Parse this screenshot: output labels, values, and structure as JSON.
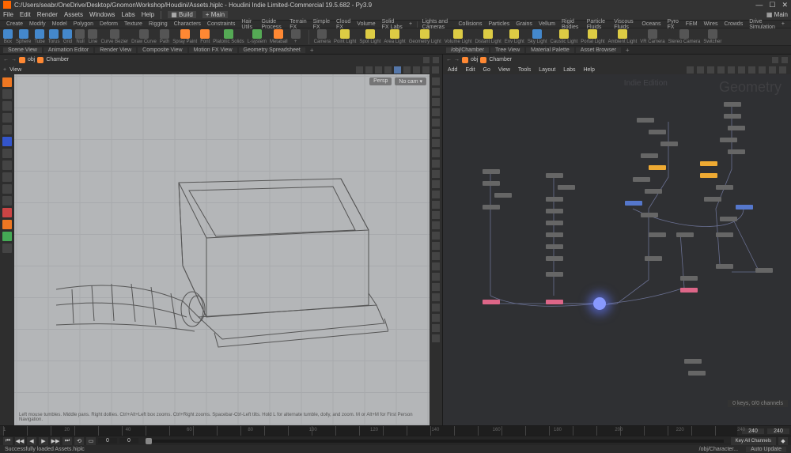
{
  "title": "C:/Users/seabr/OneDrive/Desktop/GnomonWorkshop/Houdini/Assets.hiplc - Houdini Indie Limited-Commercial 19.5.682 - Py3.9",
  "menu": [
    "File",
    "Edit",
    "Render",
    "Assets",
    "Windows",
    "Labs",
    "Help"
  ],
  "build_label": "Build",
  "main_label": "Main",
  "menu_right": "Main",
  "shelf_tabs_left": [
    "Create",
    "Modify",
    "Model",
    "Polygon",
    "Deform",
    "Texture",
    "Rigging",
    "Characters",
    "Constraints",
    "Hair Utils",
    "Guide Process",
    "Terrain FX",
    "Simple FX",
    "Cloud FX",
    "Volume",
    "Solid FX Labs"
  ],
  "shelf_tabs_right": [
    "Lights and Cameras",
    "Collisions",
    "Particles",
    "Grains",
    "Vellum",
    "Rigid Bodies",
    "Particle Fluids",
    "Viscous Fluids",
    "Oceans",
    "Pyro FX",
    "FEM",
    "Wires",
    "Crowds",
    "Drive Simulation"
  ],
  "tools_left": [
    {
      "label": "Box",
      "c": "blue"
    },
    {
      "label": "Sphere",
      "c": "blue"
    },
    {
      "label": "Tube",
      "c": "blue"
    },
    {
      "label": "Torus",
      "c": "blue"
    },
    {
      "label": "Grid",
      "c": "blue"
    },
    {
      "label": "Null",
      "c": ""
    },
    {
      "label": "Line",
      "c": ""
    },
    {
      "label": "Curve Bezier",
      "c": ""
    },
    {
      "label": "Draw Curve",
      "c": ""
    },
    {
      "label": "Path",
      "c": ""
    },
    {
      "label": "Spray Paint",
      "c": "orange"
    },
    {
      "label": "Font",
      "c": "orange"
    },
    {
      "label": "Platonic Solids",
      "c": "green"
    },
    {
      "label": "L-system",
      "c": "green"
    },
    {
      "label": "Metaball",
      "c": "orange"
    },
    {
      "label": "+",
      "c": ""
    }
  ],
  "tools_right": [
    {
      "label": "Camera",
      "c": ""
    },
    {
      "label": "Point Light",
      "c": "yellow"
    },
    {
      "label": "Spot Light",
      "c": "yellow"
    },
    {
      "label": "Area Light",
      "c": "yellow"
    },
    {
      "label": "Geometry Light",
      "c": "yellow"
    },
    {
      "label": "Volume Light",
      "c": "yellow"
    },
    {
      "label": "Distant Light",
      "c": "yellow"
    },
    {
      "label": "Env Light",
      "c": "yellow"
    },
    {
      "label": "Sky Light",
      "c": "blue"
    },
    {
      "label": "Caustic Light",
      "c": "yellow"
    },
    {
      "label": "Portal Light",
      "c": "yellow"
    },
    {
      "label": "Ambient Light",
      "c": "yellow"
    },
    {
      "label": "VR Camera",
      "c": ""
    },
    {
      "label": "Stereo Camera",
      "c": ""
    },
    {
      "label": "Switcher",
      "c": ""
    }
  ],
  "pane_tabs_left": [
    "Scene View",
    "Animation Editor",
    "Render View",
    "Composite View",
    "Motion FX View",
    "Geometry Spreadsheet"
  ],
  "pane_tabs_right": [
    "/obj/Chamber",
    "Tree View",
    "Material Palette",
    "Asset Browser"
  ],
  "path": {
    "crumb1": "obj",
    "crumb2": "Chamber"
  },
  "view_label": "View",
  "persp": "Persp",
  "nocam": "No cam",
  "viewport_hint": "Left mouse tumbles. Middle pans. Right dollies. Ctrl+Alt+Left box zooms. Ctrl+Right zooms. Spacebar-Ctrl-Left tilts. Hold L for alternate tumble, dolly, and zoom.    M or Alt+M for First Person Navigation.",
  "net_menu": [
    "Add",
    "Edit",
    "Go",
    "View",
    "Tools",
    "Layout",
    "Labs",
    "Help"
  ],
  "watermark": "Geometry",
  "watermark2": "Indie Edition",
  "timeline": {
    "start": "0",
    "end": "240",
    "frame": "240",
    "ticks": [
      "1",
      "20",
      "40",
      "60",
      "80",
      "100",
      "120",
      "140",
      "160",
      "180",
      "200",
      "220",
      "240"
    ]
  },
  "playbar": {
    "frame": "0",
    "frame2": "0"
  },
  "key_status": "0 keys, 0/0 channels",
  "key_all": "Key All Channels",
  "status": "Successfully loaded Assets.hiplc",
  "status_path": "/obj/Character...",
  "auto_update": "Auto Update"
}
